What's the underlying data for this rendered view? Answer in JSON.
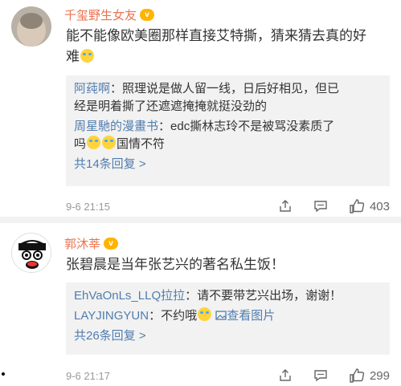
{
  "comments": [
    {
      "username": "千玺野生女友",
      "vip_badge": "v",
      "text_1": "能不能像欧美圈那样直接艾特撕，猜来猜去真的好",
      "text_2": "难",
      "replies": [
        {
          "user": "阿莼啊",
          "text_1": "照理说是做人留一线，日后好相见，但已",
          "text_2": "经是明着撕了还遮遮掩掩就挺没劲的"
        },
        {
          "user": "周星馳的漫畫书",
          "text_1": "edc撕林志玲不是被骂没素质了",
          "text_2_pre": "吗",
          "text_2_post": "国情不符"
        }
      ],
      "more_replies": "共14条回复 >",
      "time": "9-6 21:15",
      "likes": "403"
    },
    {
      "username": "郭沐莘",
      "vip_badge": "v",
      "text_1": "张碧晨是当年张艺兴的著名私生饭！",
      "replies": [
        {
          "user": "EhVaOnLs_LLQ拉拉",
          "text_1": "请不要带艺兴出场，谢谢！"
        },
        {
          "user": "LAYJINGYUN",
          "text_1": "不约哦",
          "image_link": "查看图片"
        }
      ],
      "more_replies": "共26条回复 >",
      "time": "9-6 21:17",
      "likes": "299"
    }
  ],
  "icons": {
    "share": "share-icon",
    "comment": "comment-icon",
    "like": "like-icon"
  }
}
